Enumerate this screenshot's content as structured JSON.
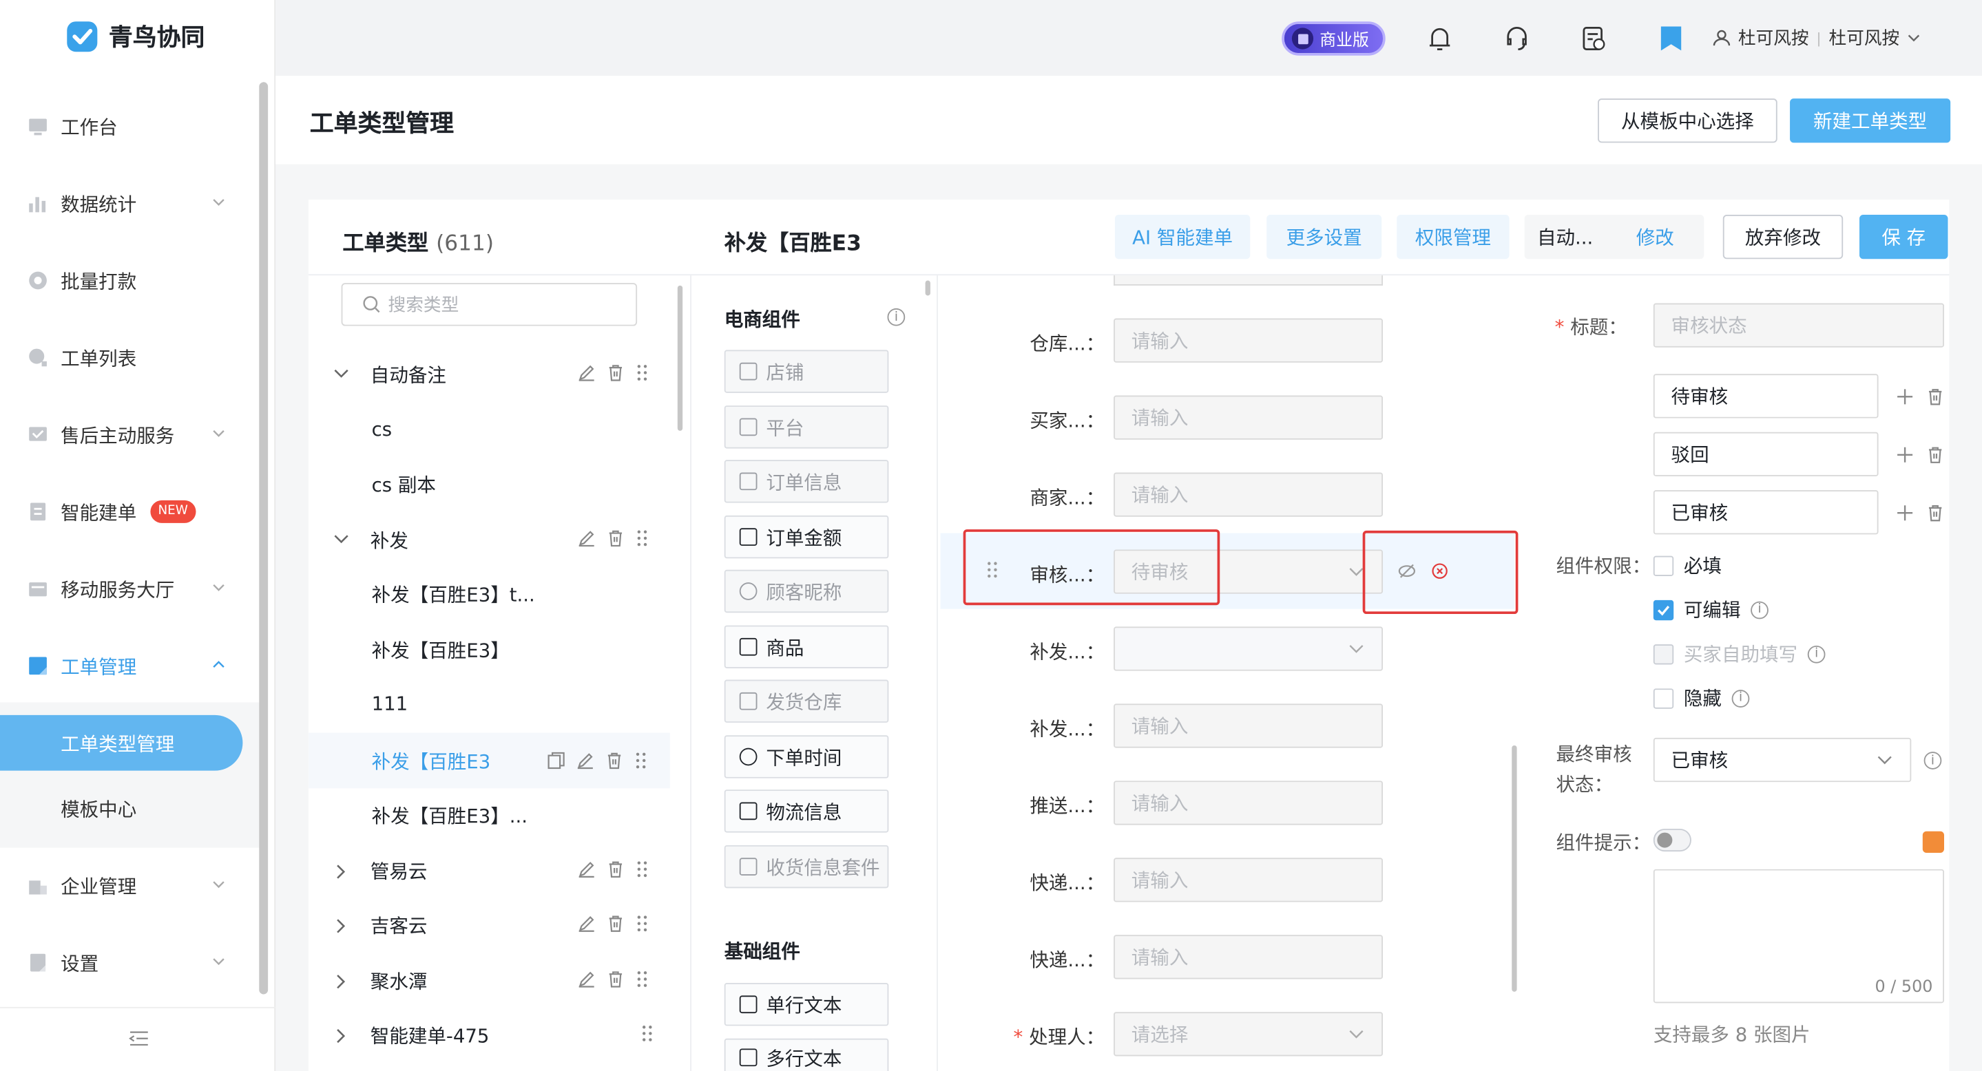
{
  "app": {
    "name": "青鸟协同"
  },
  "sidebar": {
    "items": [
      {
        "label": "工作台",
        "icon": "monitor-icon"
      },
      {
        "label": "数据统计",
        "icon": "bar-chart-icon"
      },
      {
        "label": "批量打款",
        "icon": "coin-icon"
      },
      {
        "label": "工单列表",
        "icon": "search-icon"
      },
      {
        "label": "售后主动服务",
        "icon": "chat-icon"
      },
      {
        "label": "智能建单",
        "icon": "doc-icon",
        "badge": "NEW"
      },
      {
        "label": "移动服务大厅",
        "icon": "wallet-icon"
      },
      {
        "label": "工单管理",
        "icon": "ticket-icon"
      },
      {
        "label": "工单类型管理"
      },
      {
        "label": "模板中心"
      },
      {
        "label": "企业管理",
        "icon": "building-icon"
      },
      {
        "label": "设置",
        "icon": "settings-icon"
      }
    ],
    "collapse_icon": "collapse-icon"
  },
  "topbar": {
    "edition_badge": "商业版",
    "user": "杜可风按",
    "org": "杜可风按",
    "separator": "|"
  },
  "header": {
    "title": "工单类型管理",
    "template_button": "从模板中心选择",
    "new_button": "新建工单类型"
  },
  "type_list": {
    "title": "工单类型",
    "count": "(611)",
    "search_placeholder": "搜索类型",
    "items": [
      {
        "label": "自动备注"
      },
      {
        "label": "cs"
      },
      {
        "label": "cs 副本"
      },
      {
        "label": "补发"
      },
      {
        "label": "补发【百胜E3】t..."
      },
      {
        "label": "补发【百胜E3】"
      },
      {
        "label": "111"
      },
      {
        "label": "补发【百胜E3"
      },
      {
        "label": "补发【百胜E3】..."
      },
      {
        "label": "管易云"
      },
      {
        "label": "吉客云"
      },
      {
        "label": "聚水潭"
      },
      {
        "label": "智能建单-475"
      }
    ]
  },
  "editor": {
    "title": "补发【百胜E3",
    "ai_button": "AI 智能建单",
    "more_button": "更多设置",
    "perm_button": "权限管理",
    "auto_label": "自动...",
    "modify_link": "修改",
    "discard_button": "放弃修改",
    "save_button": "保 存"
  },
  "components": {
    "ecommerce_title": "电商组件",
    "ecommerce": [
      {
        "label": "店铺",
        "disabled": true
      },
      {
        "label": "平台",
        "disabled": true
      },
      {
        "label": "订单信息",
        "disabled": true
      },
      {
        "label": "订单金额",
        "disabled": false
      },
      {
        "label": "顾客昵称",
        "disabled": true
      },
      {
        "label": "商品",
        "disabled": false
      },
      {
        "label": "发货仓库",
        "disabled": true
      },
      {
        "label": "下单时间",
        "disabled": false
      },
      {
        "label": "物流信息",
        "disabled": false
      },
      {
        "label": "收货信息套件",
        "disabled": true
      }
    ],
    "basic_title": "基础组件",
    "basic": [
      {
        "label": "单行文本"
      },
      {
        "label": "多行文本"
      }
    ]
  },
  "form": {
    "fields": [
      {
        "label": "仓库...：",
        "placeholder": "请输入"
      },
      {
        "label": "买家...：",
        "placeholder": "请输入"
      },
      {
        "label": "商家...：",
        "placeholder": "请输入"
      },
      {
        "label": "审核...：",
        "placeholder": "待审核"
      },
      {
        "label": "补发...：",
        "placeholder": ""
      },
      {
        "label": "补发...：",
        "placeholder": "请输入"
      },
      {
        "label": "推送...：",
        "placeholder": "请输入"
      },
      {
        "label": "快递...：",
        "placeholder": "请输入"
      },
      {
        "label": "快递...：",
        "placeholder": "请输入"
      },
      {
        "label": "处理人：",
        "placeholder": "请选择",
        "required": "*"
      }
    ]
  },
  "settings": {
    "title_label": "标题：",
    "title_required": "*",
    "title_value": "审核状态",
    "options": [
      "待审核",
      "驳回",
      "已审核"
    ],
    "perm_label": "组件权限：",
    "perms": [
      {
        "label": "必填",
        "checked": false,
        "disabled": false
      },
      {
        "label": "可编辑",
        "checked": true,
        "disabled": false
      },
      {
        "label": "买家自助填写",
        "checked": false,
        "disabled": true
      },
      {
        "label": "隐藏",
        "checked": false,
        "disabled": false
      }
    ],
    "final_label_1": "最终审核",
    "final_label_2": "状态：",
    "final_value": "已审核",
    "hint_label": "组件提示：",
    "hint_counter": "0 / 500",
    "image_hint": "支持最多 8 张图片",
    "accent_color": "#f28c38"
  }
}
